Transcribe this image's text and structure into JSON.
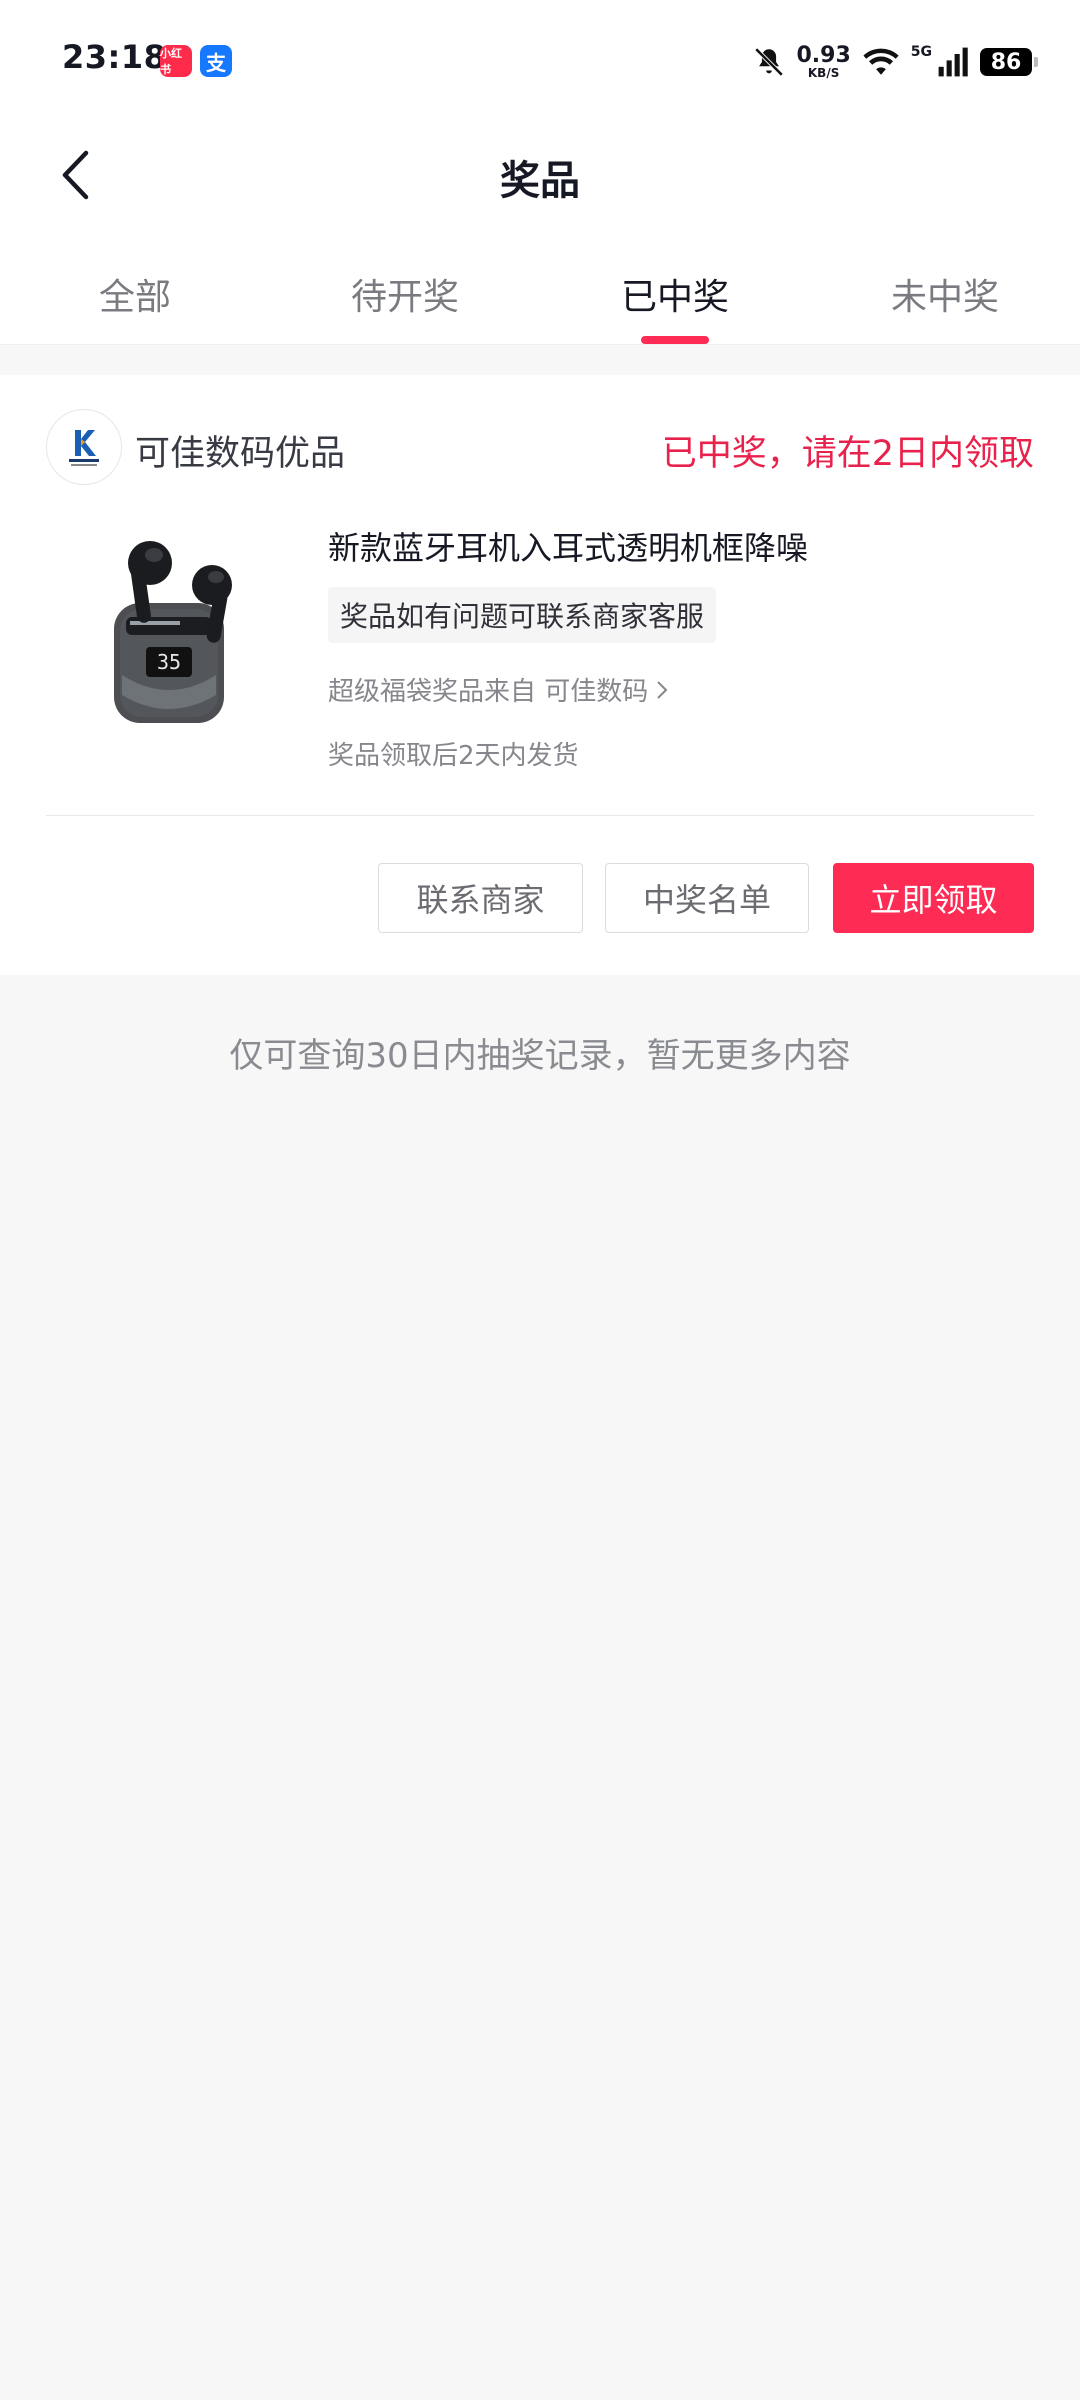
{
  "status_bar": {
    "time": "23:18",
    "apps": [
      {
        "label": "小红书",
        "icon": "xiaohongshu-icon",
        "color": "#ff2b4b"
      },
      {
        "label": "支",
        "icon": "alipay-icon",
        "color": "#1677ff"
      }
    ],
    "net_speed": "0.93",
    "net_unit": "KB/S",
    "network": "5G",
    "battery": "86"
  },
  "header": {
    "title": "奖品",
    "back_icon": "chevron-left-icon"
  },
  "tabs": [
    {
      "label": "全部",
      "active": false
    },
    {
      "label": "待开奖",
      "active": false
    },
    {
      "label": "已中奖",
      "active": true
    },
    {
      "label": "未中奖",
      "active": false
    }
  ],
  "prize": {
    "shop_name": "可佳数码优品",
    "status": "已中奖，请在2日内领取",
    "title": "新款蓝牙耳机入耳式透明机框降噪",
    "tip": "奖品如有问题可联系商家客服",
    "source": "超级福袋奖品来自 可佳数码",
    "shipping": "奖品领取后2天内发货",
    "product_display": "35",
    "buttons": {
      "contact": "联系商家",
      "winner_list": "中奖名单",
      "claim": "立即领取"
    }
  },
  "footer_note": "仅可查询30日内抽奖记录，暂无更多内容",
  "colors": {
    "accent": "#fe2c55",
    "status_text": "#e8224c"
  }
}
